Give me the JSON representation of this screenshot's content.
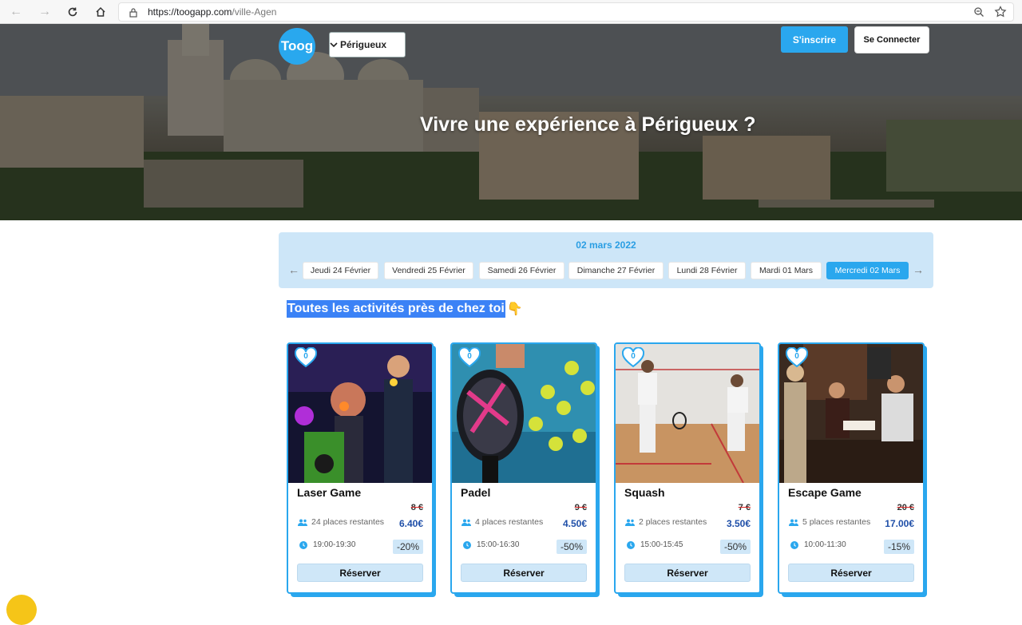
{
  "browser": {
    "url_host": "https://toogapp.com",
    "url_path": "/ville-Agen"
  },
  "header": {
    "logo_text": "Toog",
    "city_selected": "Périgueux",
    "signup_label": "S'inscrire",
    "login_label": "Se Connecter",
    "hero_title": "Vivre une expérience à Périgueux ?"
  },
  "dates": {
    "current": "02 mars 2022",
    "days": [
      {
        "label": "Jeudi 24 Février"
      },
      {
        "label": "Vendredi 25 Février"
      },
      {
        "label": "Samedi 26 Février"
      },
      {
        "label": "Dimanche 27 Février"
      },
      {
        "label": "Lundi 28 Février"
      },
      {
        "label": "Mardi 01 Mars"
      },
      {
        "label": "Mercredi 02 Mars"
      }
    ],
    "active_index": 6
  },
  "section": {
    "title": "Toutes les activités près de chez toi"
  },
  "activities": [
    {
      "name": "Laser Game",
      "likes": "0",
      "old_price": "8 €",
      "price": "6.40€",
      "places": "24 places restantes",
      "time": "19:00-19:30",
      "discount": "-20%",
      "reserve": "Réserver"
    },
    {
      "name": "Padel",
      "likes": "0",
      "old_price": "9 €",
      "price": "4.50€",
      "places": "4 places restantes",
      "time": "15:00-16:30",
      "discount": "-50%",
      "reserve": "Réserver"
    },
    {
      "name": "Squash",
      "likes": "0",
      "old_price": "7 €",
      "price": "3.50€",
      "places": "2 places restantes",
      "time": "15:00-15:45",
      "discount": "-50%",
      "reserve": "Réserver"
    },
    {
      "name": "Escape Game",
      "likes": "0",
      "old_price": "20 €",
      "price": "17.00€",
      "places": "5 places restantes",
      "time": "10:00-11:30",
      "discount": "-15%",
      "reserve": "Réserver"
    }
  ],
  "colors": {
    "accent": "#2aa7ee",
    "price": "#1f4fa8",
    "panel": "#cde6f8"
  }
}
